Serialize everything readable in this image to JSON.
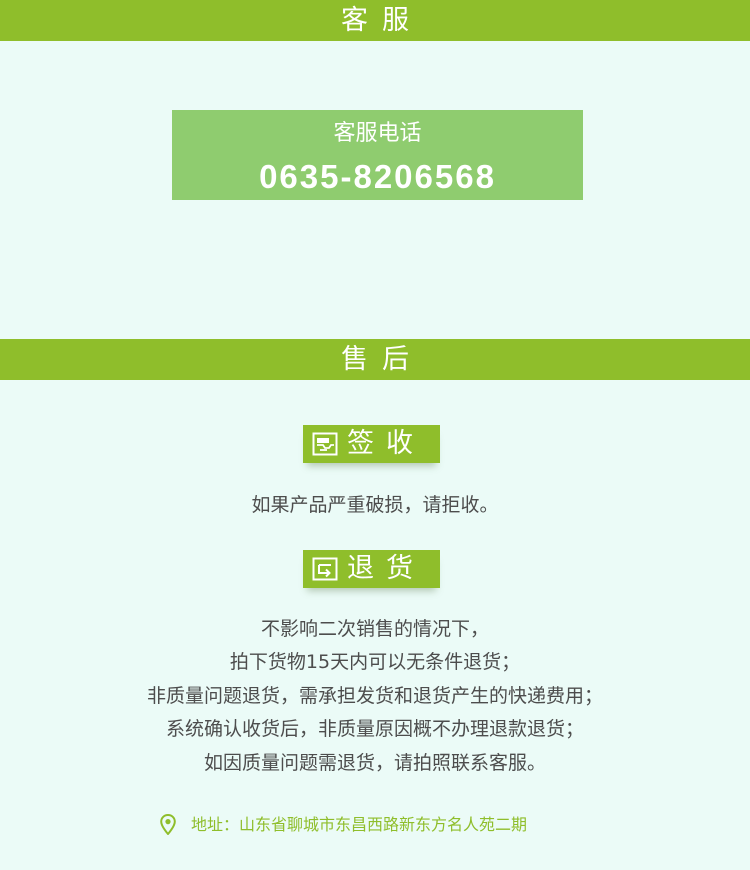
{
  "service": {
    "header": "客服",
    "phone_label": "客服电话",
    "phone_number": "0635-8206568"
  },
  "after_sales": {
    "header": "售后",
    "sign_badge": {
      "label": "签收",
      "icon": "inbox-icon",
      "text": "如果产品严重破损，请拒收。"
    },
    "return_badge": {
      "label": "退货",
      "icon": "return-arrow-icon",
      "lines": [
        "不影响二次销售的情况下，",
        "拍下货物15天内可以无条件退货；",
        "非质量问题退货，需承担发货和退货产生的快递费用；",
        "系统确认收货后，非质量原因概不办理退款退货；",
        "如因质量问题需退货，请拍照联系客服。"
      ]
    }
  },
  "footer": {
    "icon": "location-pin-icon",
    "address": "地址：山东省聊城市东昌西路新东方名人苑二期"
  },
  "colors": {
    "accent_green": "#8fbe2b",
    "phone_box": "#8fcc6f",
    "background": "#ebfbf7",
    "text": "#4d4d4d"
  }
}
